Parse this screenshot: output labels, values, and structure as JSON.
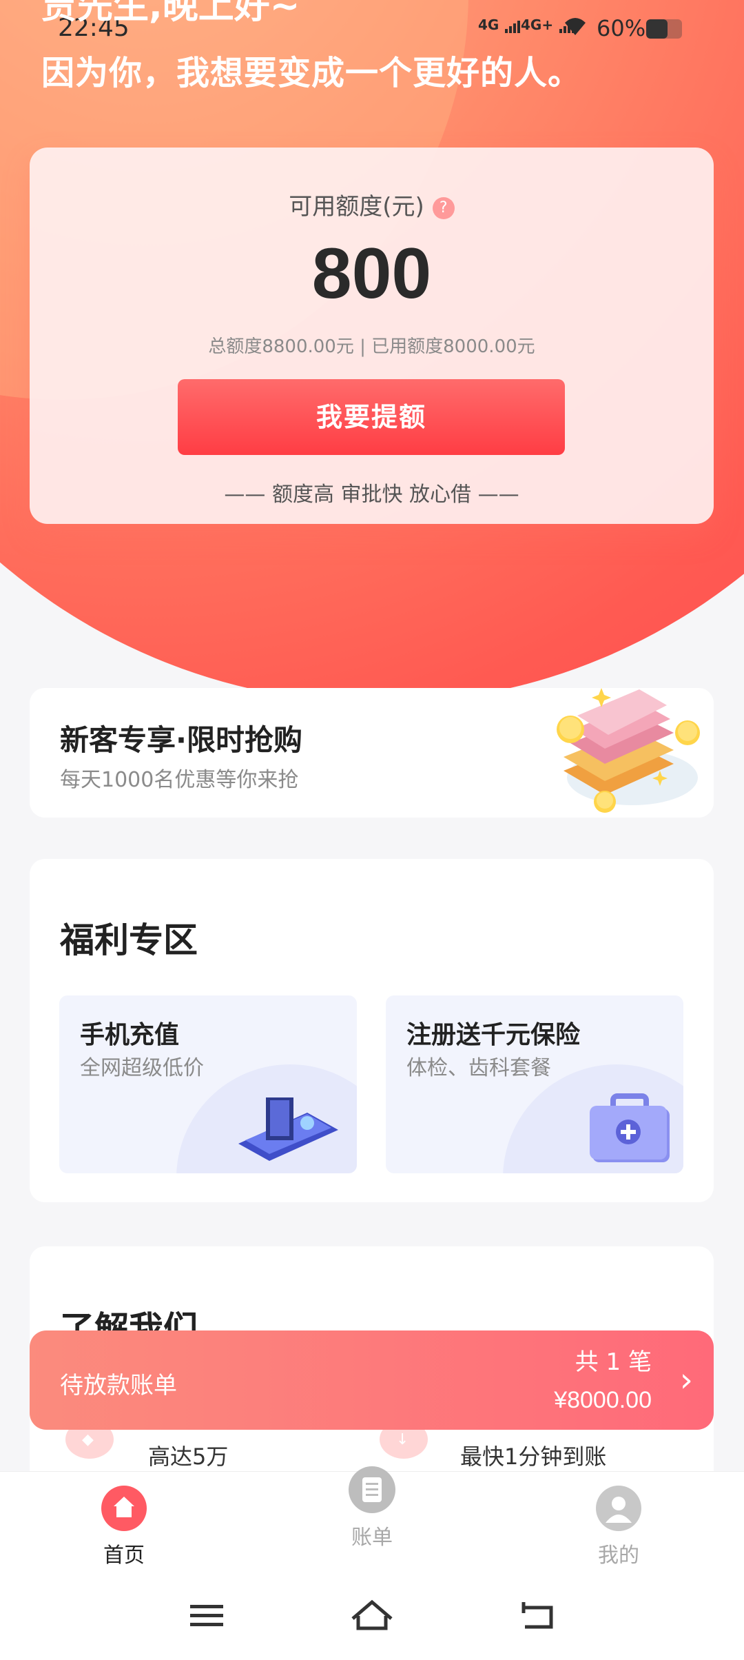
{
  "status_bar": {
    "time": "22:45",
    "signal_1": "4G",
    "signal_2": "4G+",
    "battery_pct": "60%",
    "battery_level": 0.6
  },
  "header": {
    "greeting": "贾先生,晚上好~",
    "motto": "因为你，我想要变成一个更好的人。"
  },
  "credit": {
    "label": "可用额度(元)",
    "help_icon": "?",
    "amount": "800",
    "summary": "总额度8800.00元 | 已用额度8000.00元",
    "button_label": "我要提额",
    "slogan": "—— 额度高 审批快 放心借 ——"
  },
  "promo": {
    "title": "新客专享·限时抢购",
    "subtitle": "每天1000名优惠等你来抢"
  },
  "welfare": {
    "title": "福利专区",
    "cards": [
      {
        "title": "手机充值",
        "subtitle": "全网超级低价"
      },
      {
        "title": "注册送千元保险",
        "subtitle": "体检、齿科套餐"
      }
    ]
  },
  "about": {
    "title": "了解我们",
    "features": [
      {
        "label": "高达5万"
      },
      {
        "label": "最快1分钟到账"
      }
    ]
  },
  "pending_bill": {
    "label": "待放款账单",
    "count": "共 1 笔",
    "amount": "¥8000.00"
  },
  "tabbar": {
    "items": [
      {
        "label": "首页",
        "active": true
      },
      {
        "label": "账单",
        "active": false
      },
      {
        "label": "我的",
        "active": false
      }
    ]
  },
  "colors": {
    "primary": "#ff4b4f",
    "accent_gradient_start": "#fb8b7d",
    "accent_gradient_end": "#ff6a79"
  }
}
